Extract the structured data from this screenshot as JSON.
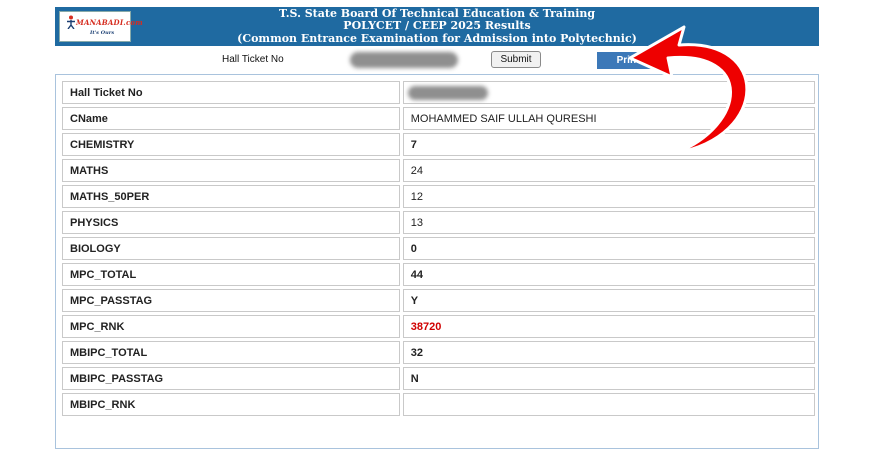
{
  "header": {
    "logo_text": "MANABADI.com",
    "logo_tagline": "It's Ours",
    "line1": "T.S. State Board Of Technical Education & Training",
    "line2": "POLYCET / CEEP 2025 Results",
    "line3": "(Common Entrance Examination for Admission into Polytechnic)"
  },
  "search": {
    "label": "Hall Ticket No",
    "submit_label": "Submit",
    "print_label": "Print"
  },
  "results": [
    {
      "key": "Hall Ticket No",
      "value": ""
    },
    {
      "key": "CName",
      "value": "MOHAMMED SAIF ULLAH QURESHI"
    },
    {
      "key": "CHEMISTRY",
      "value": "7"
    },
    {
      "key": "MATHS",
      "value": "24"
    },
    {
      "key": "MATHS_50PER",
      "value": "12"
    },
    {
      "key": "PHYSICS",
      "value": "13"
    },
    {
      "key": "BIOLOGY",
      "value": "0"
    },
    {
      "key": "MPC_TOTAL",
      "value": "44"
    },
    {
      "key": "MPC_PASSTAG",
      "value": "Y"
    },
    {
      "key": "MPC_RNK",
      "value": "38720"
    },
    {
      "key": "MBIPC_TOTAL",
      "value": "32"
    },
    {
      "key": "MBIPC_PASSTAG",
      "value": "N"
    },
    {
      "key": "MBIPC_RNK",
      "value": ""
    }
  ],
  "colors": {
    "banner": "#1f6aa1",
    "rank_highlight": "#d00000",
    "annotation_arrow": "#ee0000"
  },
  "icons": {
    "annotation": "curved-arrow-icon"
  }
}
